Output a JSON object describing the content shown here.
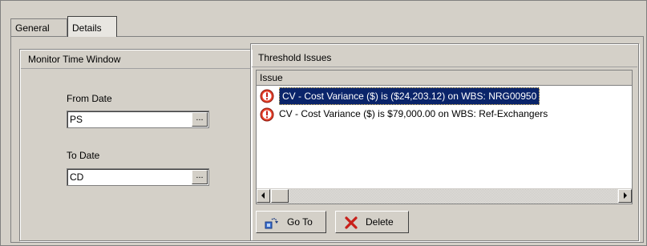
{
  "tabs": [
    {
      "label": "General",
      "active": false
    },
    {
      "label": "Details",
      "active": true
    }
  ],
  "monitor": {
    "title": "Monitor Time Window",
    "from_label": "From Date",
    "from_value": "PS",
    "to_label": "To Date",
    "to_value": "CD",
    "browse_label": "..."
  },
  "threshold": {
    "title": "Threshold Issues",
    "column": "Issue",
    "issues": [
      {
        "text": "CV - Cost Variance ($) is ($24,203.12) on WBS: NRG00950",
        "selected": true,
        "icon": "warning-icon"
      },
      {
        "text": "CV - Cost Variance ($) is $79,000.00 on WBS: Ref-Exchangers",
        "selected": false,
        "icon": "warning-icon"
      }
    ],
    "buttons": {
      "goto": "Go To",
      "delete": "Delete"
    }
  },
  "colors": {
    "selection": "#0a246a",
    "warning": "#e8412a"
  }
}
